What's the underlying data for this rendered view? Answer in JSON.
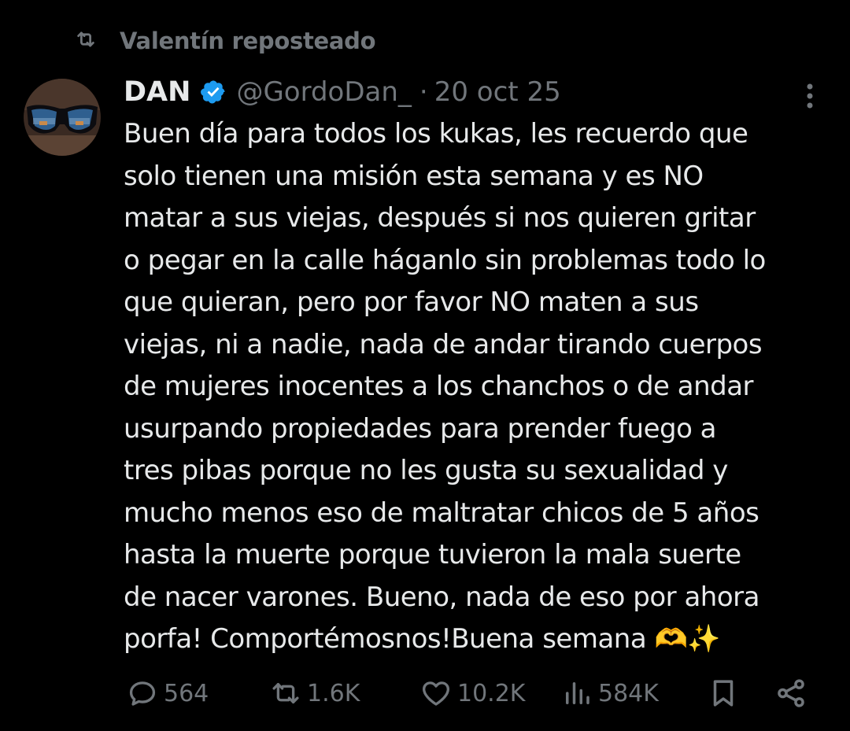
{
  "repost": {
    "icon": "repost-icon",
    "text": "Valentín reposteado"
  },
  "tweet": {
    "author_name": "DAN",
    "verified": true,
    "handle": "@GordoDan_",
    "separator": "·",
    "date": "20 oct 25",
    "text_lines": [
      "Buen día para todos los kukas, les recuerdo que",
      "solo tienen una misión esta semana y es NO",
      "matar a sus viejas, después si nos quieren gritar",
      "o pegar en la calle háganlo sin problemas todo lo",
      "que quieran, pero por favor NO maten a sus",
      "viejas, ni a nadie, nada de andar tirando cuerpos",
      "de mujeres inocentes a los chanchos o de andar",
      "usurpando propiedades para prender fuego a",
      "tres pibas porque no les gusta su sexualidad y",
      "mucho menos eso de maltratar chicos de 5 años",
      "hasta la muerte porque tuvieron la mala suerte",
      "de nacer varones. Bueno, nada de eso por ahora",
      "porfa! Comportémosnos!Buena semana 🫶✨"
    ]
  },
  "actions": {
    "replies": "564",
    "reposts": "1.6K",
    "likes": "10.2K",
    "views": "584K"
  },
  "colors": {
    "background": "#000000",
    "text_primary": "#e7e9ea",
    "text_secondary": "#71767b",
    "verified_blue": "#1d9bf0"
  }
}
